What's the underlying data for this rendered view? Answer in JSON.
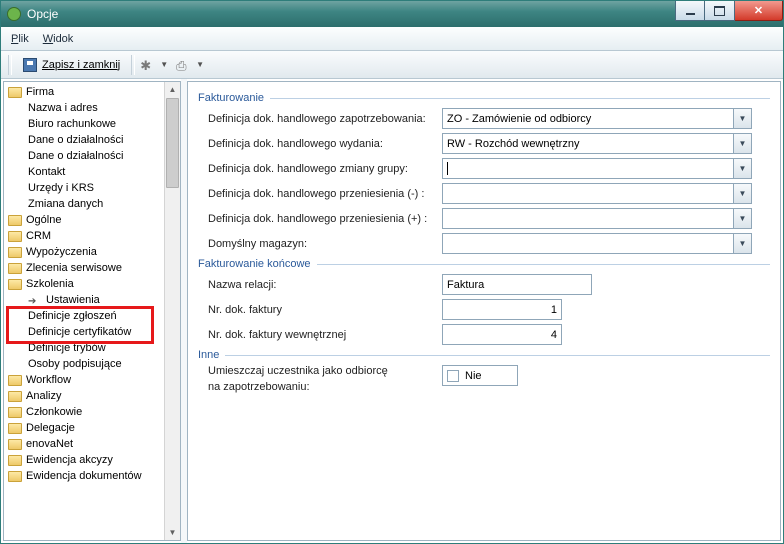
{
  "title": "Opcje",
  "menu": {
    "file": "Plik",
    "view": "Widok"
  },
  "toolbar": {
    "save": "Zapisz i zamknij"
  },
  "tree": {
    "firma": "Firma",
    "firma_children": [
      "Nazwa i adres",
      "Biuro rachunkowe",
      "Dane o działalności",
      "Dane o działalności",
      "Kontakt",
      "Urzędy i KRS",
      "Zmiana danych"
    ],
    "ogolne": "Ogólne",
    "crm": "CRM",
    "wypozyczenia": "Wypożyczenia",
    "zlecenia": "Zlecenia serwisowe",
    "szkolenia": "Szkolenia",
    "szkolenia_children": [
      "Ustawienia",
      "Definicje zgłoszeń",
      "Definicje certyfikatów",
      "Definicje trybów",
      "Osoby podpisujące"
    ],
    "workflow": "Workflow",
    "analizy": "Analizy",
    "czlonkowie": "Członkowie",
    "delegacje": "Delegacje",
    "enovanet": "enovaNet",
    "ewidencja_akcyzy": "Ewidencja akcyzy",
    "ewidencja_dokument": "Ewidencja dokumentów"
  },
  "groups": {
    "fakturowanie": "Fakturowanie",
    "fakt_koncowe": "Fakturowanie końcowe",
    "inne": "Inne"
  },
  "fields": {
    "def_zap": {
      "label": "Definicja dok. handlowego zapotrzebowania:",
      "value": "ZO - Zamówienie od odbiorcy"
    },
    "def_wyd": {
      "label": "Definicja dok. handlowego wydania:",
      "value": "RW - Rozchód wewnętrzny"
    },
    "def_zg": {
      "label": "Definicja dok. handlowego zmiany grupy:",
      "value": ""
    },
    "def_pm": {
      "label": "Definicja dok. handlowego przeniesienia (-) :",
      "value": ""
    },
    "def_pp": {
      "label": "Definicja dok. handlowego przeniesienia (+) :",
      "value": ""
    },
    "mag": {
      "label": "Domyślny magazyn:",
      "value": ""
    },
    "relacja": {
      "label": "Nazwa relacji:",
      "value": "Faktura"
    },
    "nrdok": {
      "label": "Nr. dok. faktury",
      "value": "1"
    },
    "nrdokw": {
      "label": "Nr. dok. faktury wewnętrznej",
      "value": "4"
    },
    "umiesz": {
      "label1": "Umieszczaj uczestnika jako odbiorcę",
      "label2": "na zapotrzebowaniu:",
      "value": "Nie"
    }
  }
}
